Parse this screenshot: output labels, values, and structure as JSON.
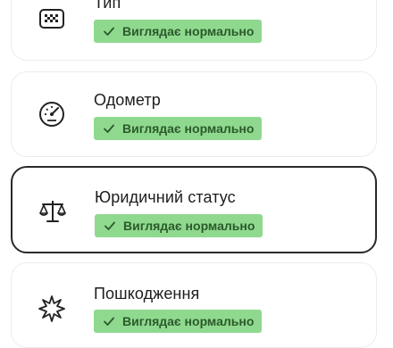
{
  "checks": [
    {
      "title": "Тип",
      "status": "Виглядає нормально",
      "icon": "taxi-icon",
      "selected": false
    },
    {
      "title": "Одометр",
      "status": "Виглядає нормально",
      "icon": "speedometer-icon",
      "selected": false
    },
    {
      "title": "Юридичний статус",
      "status": "Виглядає нормально",
      "icon": "scales-icon",
      "selected": true
    },
    {
      "title": "Пошкодження",
      "status": "Виглядає нормально",
      "icon": "damage-burst-icon",
      "selected": false
    }
  ],
  "colors": {
    "status_pill": "#8fd98f",
    "status_text": "#2b5a2b",
    "selected_border": "#2a2a2a",
    "card_border": "#ececec"
  }
}
